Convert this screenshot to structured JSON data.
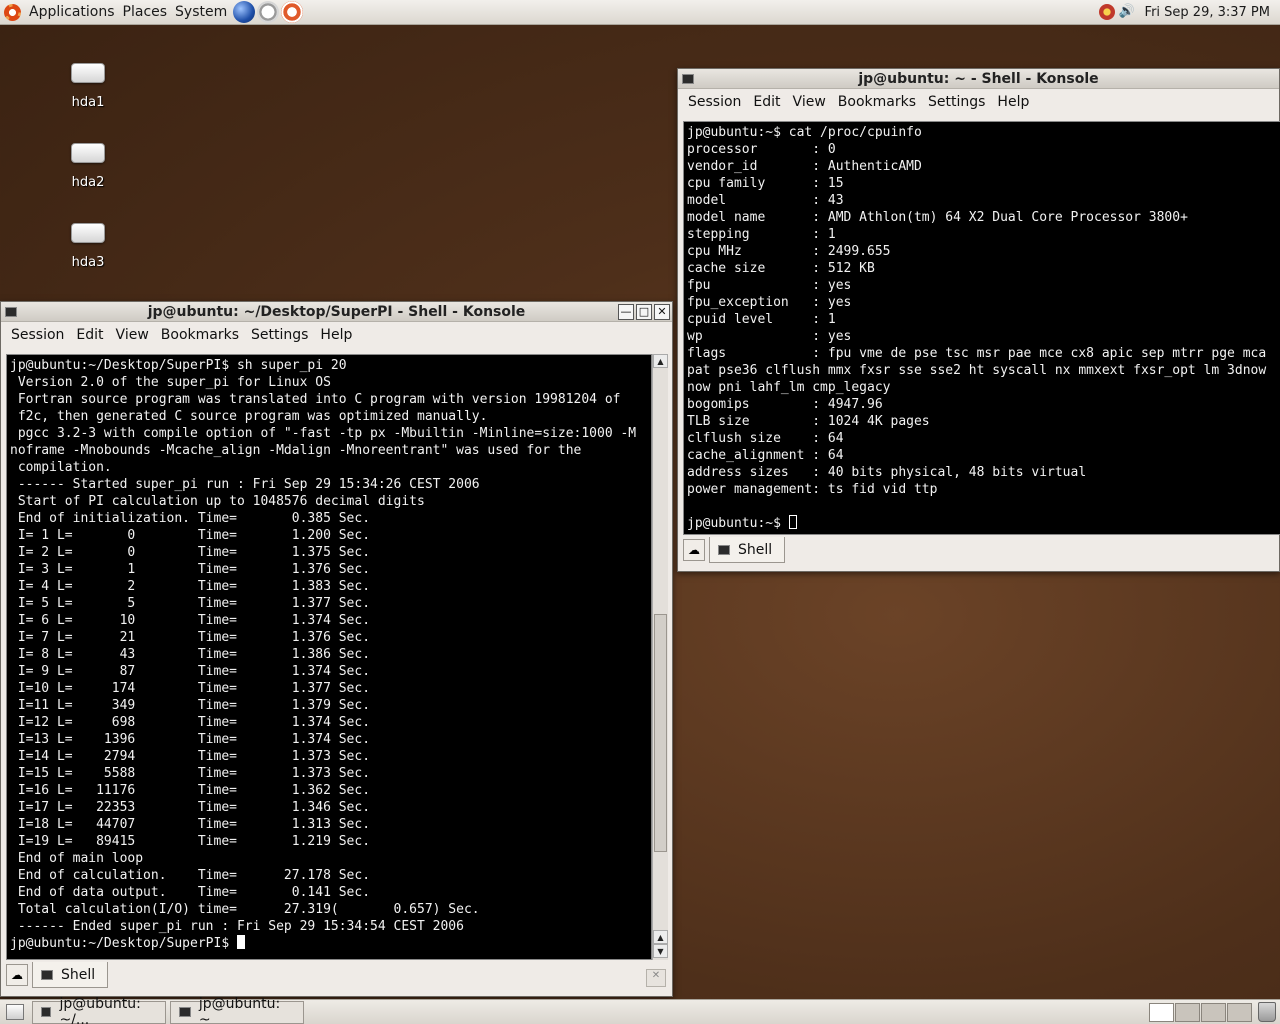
{
  "top_panel": {
    "menus": [
      "Applications",
      "Places",
      "System"
    ],
    "clock": "Fri Sep 29,  3:37 PM",
    "volume_symbol": "🔊"
  },
  "desktop_icons": [
    {
      "label": "hda1"
    },
    {
      "label": "hda2"
    },
    {
      "label": "hda3"
    }
  ],
  "window_superpi": {
    "title": "jp@ubuntu: ~/Desktop/SuperPI - Shell - Konsole",
    "menu": [
      "Session",
      "Edit",
      "View",
      "Bookmarks",
      "Settings",
      "Help"
    ],
    "lines": [
      "jp@ubuntu:~/Desktop/SuperPI$ sh super_pi 20",
      " Version 2.0 of the super_pi for Linux OS",
      " Fortran source program was translated into C program with version 19981204 of",
      " f2c, then generated C source program was optimized manually.",
      " pgcc 3.2-3 with compile option of \"-fast -tp px -Mbuiltin -Minline=size:1000 -M",
      "noframe -Mnobounds -Mcache_align -Mdalign -Mnoreentrant\" was used for the",
      " compilation.",
      " ------ Started super_pi run : Fri Sep 29 15:34:26 CEST 2006",
      " Start of PI calculation up to 1048576 decimal digits",
      " End of initialization. Time=       0.385 Sec.",
      " I= 1 L=       0        Time=       1.200 Sec.",
      " I= 2 L=       0        Time=       1.375 Sec.",
      " I= 3 L=       1        Time=       1.376 Sec.",
      " I= 4 L=       2        Time=       1.383 Sec.",
      " I= 5 L=       5        Time=       1.377 Sec.",
      " I= 6 L=      10        Time=       1.374 Sec.",
      " I= 7 L=      21        Time=       1.376 Sec.",
      " I= 8 L=      43        Time=       1.386 Sec.",
      " I= 9 L=      87        Time=       1.374 Sec.",
      " I=10 L=     174        Time=       1.377 Sec.",
      " I=11 L=     349        Time=       1.379 Sec.",
      " I=12 L=     698        Time=       1.374 Sec.",
      " I=13 L=    1396        Time=       1.374 Sec.",
      " I=14 L=    2794        Time=       1.373 Sec.",
      " I=15 L=    5588        Time=       1.373 Sec.",
      " I=16 L=   11176        Time=       1.362 Sec.",
      " I=17 L=   22353        Time=       1.346 Sec.",
      " I=18 L=   44707        Time=       1.313 Sec.",
      " I=19 L=   89415        Time=       1.219 Sec.",
      " End of main loop",
      " End of calculation.    Time=      27.178 Sec.",
      " End of data output.    Time=       0.141 Sec.",
      " Total calculation(I/O) time=      27.319(       0.657) Sec.",
      " ------ Ended super_pi run : Fri Sep 29 15:34:54 CEST 2006"
    ],
    "prompt": "jp@ubuntu:~/Desktop/SuperPI$ ",
    "tab_label": "Shell"
  },
  "window_cpuinfo": {
    "title": "jp@ubuntu: ~ - Shell - Konsole",
    "menu": [
      "Session",
      "Edit",
      "View",
      "Bookmarks",
      "Settings",
      "Help"
    ],
    "lines": [
      "jp@ubuntu:~$ cat /proc/cpuinfo",
      "processor       : 0",
      "vendor_id       : AuthenticAMD",
      "cpu family      : 15",
      "model           : 43",
      "model name      : AMD Athlon(tm) 64 X2 Dual Core Processor 3800+",
      "stepping        : 1",
      "cpu MHz         : 2499.655",
      "cache size      : 512 KB",
      "fpu             : yes",
      "fpu_exception   : yes",
      "cpuid level     : 1",
      "wp              : yes",
      "flags           : fpu vme de pse tsc msr pae mce cx8 apic sep mtrr pge mca",
      "pat pse36 clflush mmx fxsr sse sse2 ht syscall nx mmxext fxsr_opt lm 3dnow",
      "now pni lahf_lm cmp_legacy",
      "bogomips        : 4947.96",
      "TLB size        : 1024 4K pages",
      "clflush size    : 64",
      "cache_alignment : 64",
      "address sizes   : 40 bits physical, 48 bits virtual",
      "power management: ts fid vid ttp",
      ""
    ],
    "prompt": "jp@ubuntu:~$ ",
    "tab_label": "Shell"
  },
  "bottom_panel": {
    "tasks": [
      "jp@ubuntu: ~/...",
      "jp@ubuntu: ~"
    ]
  }
}
